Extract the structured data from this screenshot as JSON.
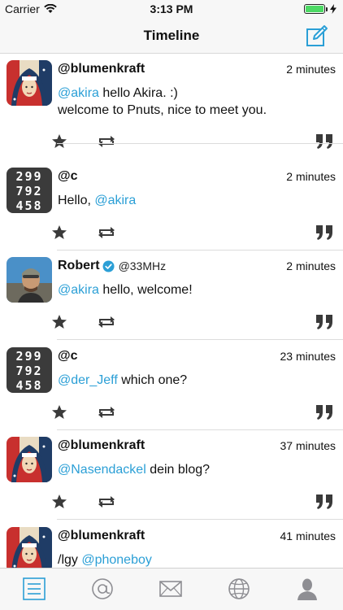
{
  "status_bar": {
    "carrier": "Carrier",
    "time": "3:13 PM",
    "battery_level": 1.0
  },
  "nav": {
    "title": "Timeline",
    "compose_icon": "compose-icon"
  },
  "posts": [
    {
      "username": "@blumenkraft",
      "time": "2 minutes",
      "avatar": "flag-portrait",
      "mention": "@akira",
      "text": " hello Akira. :)",
      "line2": "welcome to Pnuts, nice to meet you."
    },
    {
      "username": "@c",
      "time": "2 minutes",
      "avatar": "number-grid",
      "avatar_rows": [
        "299",
        "792",
        "458"
      ],
      "prefix": "Hello, ",
      "mention": "@akira"
    },
    {
      "username": "Robert",
      "handle": "@33MHz",
      "verified": true,
      "time": "2 minutes",
      "avatar": "selfie-photo",
      "mention": "@akira",
      "text": " hello, welcome!"
    },
    {
      "username": "@c",
      "time": "23 minutes",
      "avatar": "number-grid",
      "avatar_rows": [
        "299",
        "792",
        "458"
      ],
      "mention": "@der_Jeff",
      "text": " which one?"
    },
    {
      "username": "@blumenkraft",
      "time": "37 minutes",
      "avatar": "flag-portrait",
      "mention": "@Nasendackel",
      "text": " dein blog?"
    },
    {
      "username": "@blumenkraft",
      "time": "41 minutes",
      "avatar": "flag-portrait",
      "prefix": "/lgy ",
      "mention": "@phoneboy"
    }
  ],
  "tabs": [
    {
      "name": "timeline-tab",
      "icon": "list-icon",
      "active": true
    },
    {
      "name": "mentions-tab",
      "icon": "at-icon",
      "active": false
    },
    {
      "name": "messages-tab",
      "icon": "envelope-icon",
      "active": false
    },
    {
      "name": "global-tab",
      "icon": "globe-icon",
      "active": false
    },
    {
      "name": "profile-tab",
      "icon": "person-icon",
      "active": false
    }
  ],
  "colors": {
    "accent": "#2b9fd6",
    "icon": "#3a3a3a",
    "tab_inactive": "#8e8e93",
    "tab_active": "#2b9fd6"
  }
}
